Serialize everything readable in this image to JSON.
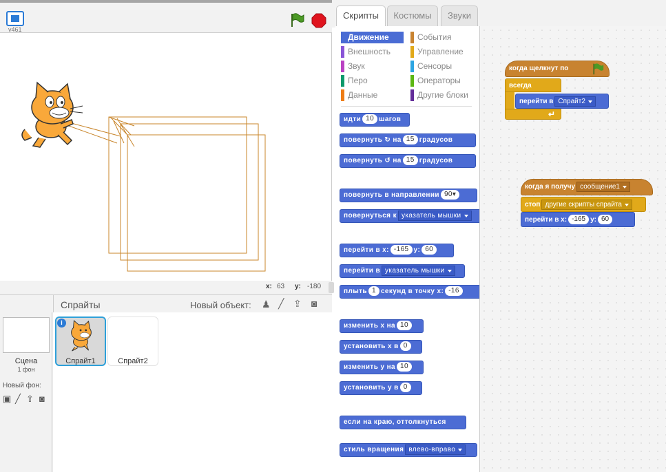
{
  "stage": {
    "version": "v461",
    "coords": {
      "x_label": "x:",
      "x": "63",
      "y_label": "y:",
      "y": "-180"
    }
  },
  "sprites_panel": {
    "title": "Спрайты",
    "new_object_label": "Новый объект:",
    "sprites": [
      {
        "name": "Спрайт1",
        "selected": true
      },
      {
        "name": "Спрайт2",
        "selected": false
      }
    ]
  },
  "scene_panel": {
    "label": "Сцена",
    "count": "1 фон",
    "new_backdrop_label": "Новый фон:"
  },
  "tabs": [
    "Скрипты",
    "Костюмы",
    "Звуки"
  ],
  "categories": [
    {
      "label": "Движение",
      "color": "#4a6cd4",
      "active": true
    },
    {
      "label": "Внешность",
      "color": "#8a55d7"
    },
    {
      "label": "Звук",
      "color": "#bb42c3"
    },
    {
      "label": "Перо",
      "color": "#0e9a6c"
    },
    {
      "label": "Данные",
      "color": "#ee7d16"
    },
    {
      "label": "События",
      "color": "#c88330"
    },
    {
      "label": "Управление",
      "color": "#e1a91a"
    },
    {
      "label": "Сенсоры",
      "color": "#2ca5e2"
    },
    {
      "label": "Операторы",
      "color": "#5cb712"
    },
    {
      "label": "Другие блоки",
      "color": "#632d99"
    }
  ],
  "palette_blocks": {
    "move": {
      "t1": "идти",
      "v": "10",
      "t2": "шагов"
    },
    "turn_right": {
      "t1": "повернуть",
      "icon": "↻",
      "t2": "на",
      "v": "15",
      "t3": "градусов"
    },
    "turn_left": {
      "t1": "повернуть",
      "icon": "↺",
      "t2": "на",
      "v": "15",
      "t3": "градусов"
    },
    "point_dir": {
      "t1": "повернуть в направлении",
      "v": "90▾"
    },
    "point_towards": {
      "t1": "повернуться к",
      "dd": "указатель мышки"
    },
    "goto_xy": {
      "t1": "перейти в x:",
      "x": "-165",
      "t2": "y:",
      "y": "60"
    },
    "goto": {
      "t1": "перейти в",
      "dd": "указатель мышки"
    },
    "glide": {
      "t1": "плыть",
      "v": "1",
      "t2": "секунд в точку x:",
      "x": "-16"
    },
    "change_x": {
      "t1": "изменить х на",
      "v": "10"
    },
    "set_x": {
      "t1": "установить х в",
      "v": "0"
    },
    "change_y": {
      "t1": "изменить у на",
      "v": "10"
    },
    "set_y": {
      "t1": "установить у в",
      "v": "0"
    },
    "bounce": {
      "t1": "если на краю, оттолкнуться"
    },
    "rotation": {
      "t1": "стиль вращения",
      "dd": "влево-вправо"
    }
  },
  "scripts": {
    "script1": {
      "hat": "когда щелкнут по",
      "forever": "всегда",
      "goto_t": "перейти в",
      "goto_dd": "Спрайт2"
    },
    "script2": {
      "hat": "когда я получу",
      "hat_dd": "сообщение1",
      "stop_t": "стоп",
      "stop_dd": "другие скрипты спрайта",
      "goto_t1": "перейти в x:",
      "x": "-165",
      "goto_t2": "y:",
      "y": "60"
    }
  }
}
